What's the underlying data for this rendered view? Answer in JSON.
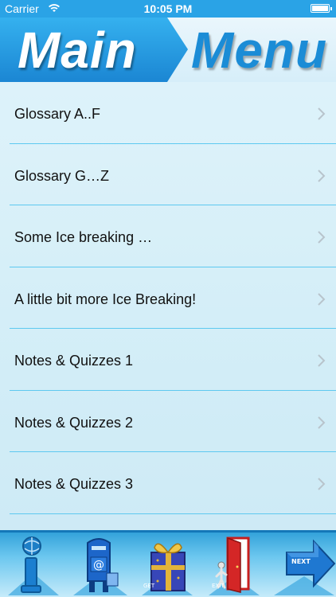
{
  "status_bar": {
    "carrier": "Carrier",
    "time": "10:05 PM"
  },
  "header": {
    "title_left": "Main",
    "title_right": "Menu"
  },
  "menu": {
    "items": [
      {
        "label": "Glossary A..F"
      },
      {
        "label": "Glossary G…Z"
      },
      {
        "label": "Some Ice breaking …"
      },
      {
        "label": "A little bit more Ice Breaking!"
      },
      {
        "label": "Notes & Quizzes 1"
      },
      {
        "label": "Notes & Quizzes 2"
      },
      {
        "label": "Notes & Quizzes 3"
      }
    ]
  },
  "toolbar": {
    "buttons": [
      {
        "icon": "info-icon",
        "tag": ""
      },
      {
        "icon": "mailbox-icon",
        "tag": ""
      },
      {
        "icon": "gift-icon",
        "tag": "GET"
      },
      {
        "icon": "exit-door-icon",
        "tag": "EXIT"
      },
      {
        "icon": "next-arrow-icon",
        "tag": "NEXT"
      }
    ]
  },
  "colors": {
    "status_bar": "#2aa3e6",
    "header_blue": "#1b86d3",
    "divider": "#5ec9f0",
    "background": "#d3eef8"
  }
}
